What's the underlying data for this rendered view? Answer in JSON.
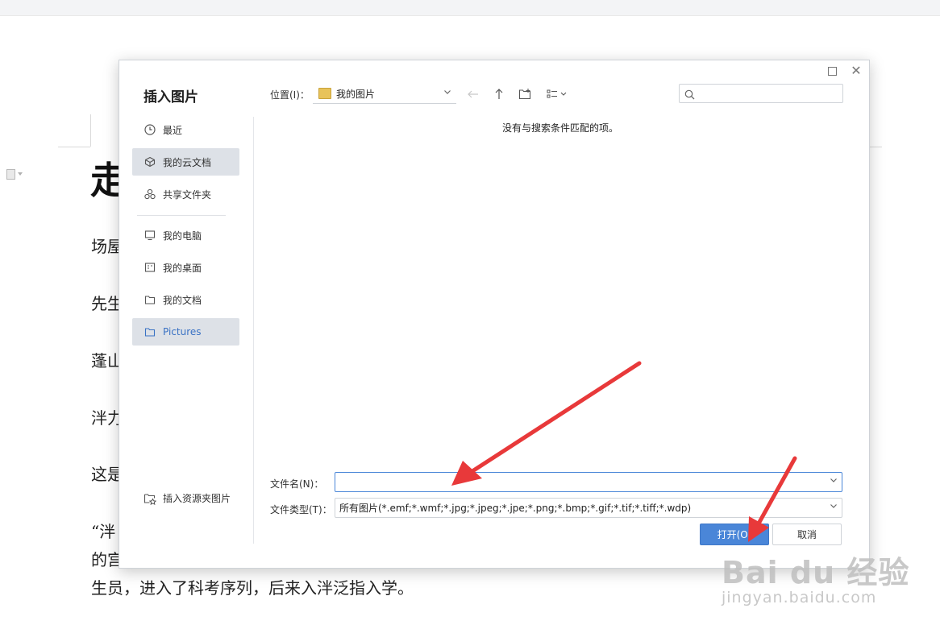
{
  "document": {
    "title_char": "走",
    "lines": [
      "场屋",
      "先生",
      "蓬山",
      "泮力",
      "这是",
      "“泮",
      "的宫",
      "生员，进入了科考序列，后来入泮泛指入学。"
    ]
  },
  "dialog": {
    "title": "插入图片",
    "sidebar": {
      "items": [
        {
          "label": "最近",
          "icon": "clock-icon"
        },
        {
          "label": "我的云文档",
          "icon": "cloud-cube-icon"
        },
        {
          "label": "共享文件夹",
          "icon": "share-nodes-icon"
        },
        {
          "label": "我的电脑",
          "icon": "monitor-icon"
        },
        {
          "label": "我的桌面",
          "icon": "desktop-icon"
        },
        {
          "label": "我的文档",
          "icon": "folder-icon"
        },
        {
          "label": "Pictures",
          "icon": "folder-icon"
        }
      ],
      "resource_link": "插入资源夹图片"
    },
    "location": {
      "label": "位置(I)：",
      "value": "我的图片"
    },
    "search": {
      "placeholder": ""
    },
    "empty_message": "没有与搜索条件匹配的项。",
    "filename": {
      "label": "文件名(N)：",
      "value": ""
    },
    "filetype": {
      "label": "文件类型(T)：",
      "value": "所有图片(*.emf;*.wmf;*.jpg;*.jpeg;*.jpe;*.png;*.bmp;*.gif;*.tif;*.tiff;*.wdp)"
    },
    "buttons": {
      "open": "打开(O)",
      "cancel": "取消"
    }
  },
  "watermark": {
    "logo": "Bai du 经验",
    "url": "jingyan.baidu.com"
  },
  "colors": {
    "accent": "#4a86d8",
    "annotation": "#e8393a",
    "selected_bg": "#dde1e7"
  }
}
